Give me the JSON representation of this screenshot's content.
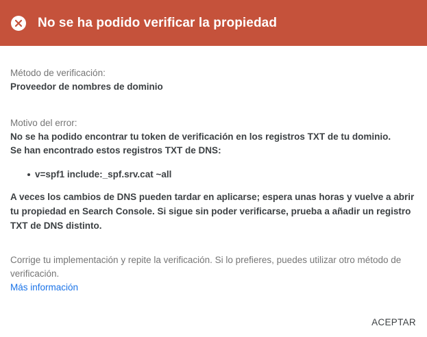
{
  "header": {
    "title": "No se ha podido verificar la propiedad",
    "icon": "error-close-icon",
    "color": "#c5523b"
  },
  "method": {
    "label": "Método de verificación:",
    "value": "Proveedor de nombres de dominio"
  },
  "reason": {
    "label": "Motivo del error:",
    "line1": "No se ha podido encontrar tu token de verificación en los registros TXT de tu dominio.",
    "line2": "Se han encontrado estos registros TXT de DNS:",
    "records": [
      "v=spf1 include:_spf.srv.cat ~all"
    ]
  },
  "dns_note": "A veces los cambios de DNS pueden tardar en aplicarse; espera unas horas y vuelve a abrir tu propiedad en Search Console. Si sigue sin poder verificarse, prueba a añadir un registro TXT de DNS distinto.",
  "fix_note": "Corrige tu implementación y repite la verificación. Si lo prefieres, puedes utilizar otro método de verificación.",
  "more_info_link": "Más información",
  "accept_button": "ACEPTAR"
}
